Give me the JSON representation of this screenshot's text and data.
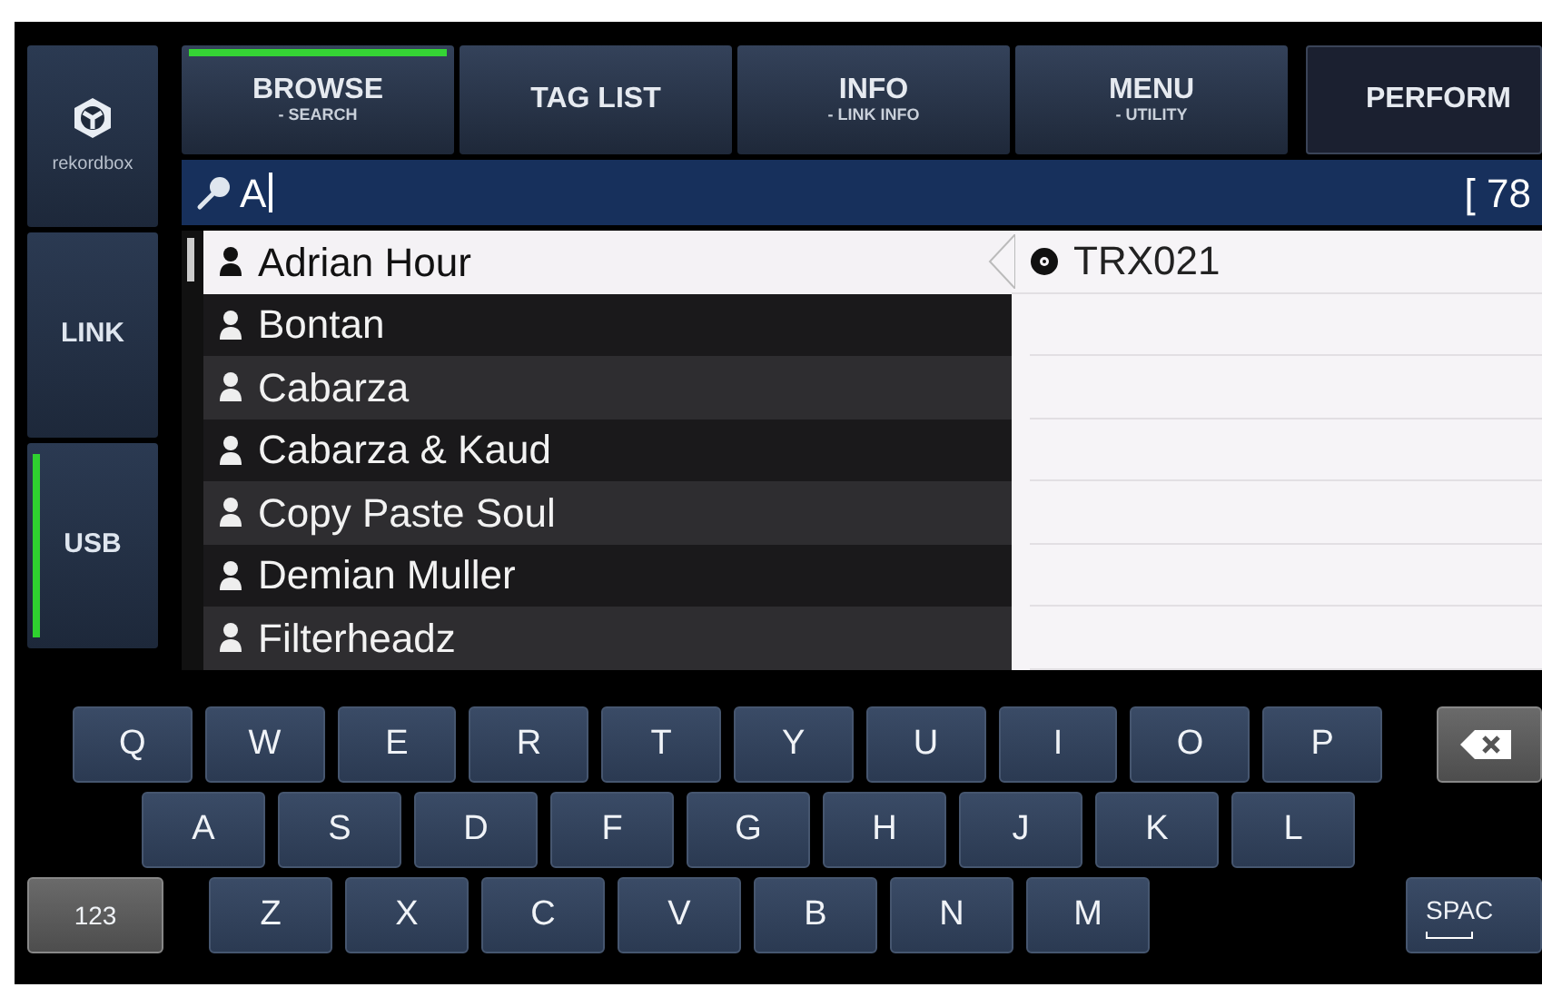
{
  "sidebar": {
    "items": [
      {
        "kind": "logo",
        "label": "rekordbox",
        "selected": false
      },
      {
        "kind": "source",
        "label": "LINK",
        "selected": false
      },
      {
        "kind": "source",
        "label": "USB",
        "selected": true
      }
    ]
  },
  "tabs": [
    {
      "label": "BROWSE",
      "sublabel": "- SEARCH",
      "selected": true
    },
    {
      "label": "TAG LIST",
      "selected": false
    },
    {
      "label": "INFO",
      "sublabel": "- LINK INFO",
      "selected": false
    },
    {
      "label": "MENU",
      "sublabel": "- UTILITY",
      "selected": false
    },
    {
      "label": "PERFORM",
      "selected": false
    }
  ],
  "search": {
    "value": "A",
    "count": "[ 78"
  },
  "artists": [
    {
      "name": "Adrian Hour",
      "selected": true
    },
    {
      "name": "Bontan",
      "selected": false
    },
    {
      "name": "Cabarza",
      "selected": false
    },
    {
      "name": "Cabarza & Kaud",
      "selected": false
    },
    {
      "name": "Copy Paste Soul",
      "selected": false
    },
    {
      "name": "Demian Muller",
      "selected": false
    },
    {
      "name": "Filterheadz",
      "selected": false
    }
  ],
  "albums": [
    {
      "title": "TRX021"
    }
  ],
  "keyboard": {
    "rows": [
      [
        {
          "kind": "letter",
          "label": "Q"
        },
        {
          "kind": "letter",
          "label": "W"
        },
        {
          "kind": "letter",
          "label": "E"
        },
        {
          "kind": "letter",
          "label": "R"
        },
        {
          "kind": "letter",
          "label": "T"
        },
        {
          "kind": "letter",
          "label": "Y"
        },
        {
          "kind": "letter",
          "label": "U"
        },
        {
          "kind": "letter",
          "label": "I"
        },
        {
          "kind": "letter",
          "label": "O"
        },
        {
          "kind": "letter",
          "label": "P"
        },
        {
          "kind": "backspace"
        }
      ],
      [
        {
          "kind": "letter",
          "label": "A"
        },
        {
          "kind": "letter",
          "label": "S"
        },
        {
          "kind": "letter",
          "label": "D"
        },
        {
          "kind": "letter",
          "label": "F"
        },
        {
          "kind": "letter",
          "label": "G"
        },
        {
          "kind": "letter",
          "label": "H"
        },
        {
          "kind": "letter",
          "label": "J"
        },
        {
          "kind": "letter",
          "label": "K"
        },
        {
          "kind": "letter",
          "label": "L"
        }
      ],
      [
        {
          "kind": "function",
          "label": "123"
        },
        {
          "kind": "letter",
          "label": "Z"
        },
        {
          "kind": "letter",
          "label": "X"
        },
        {
          "kind": "letter",
          "label": "C"
        },
        {
          "kind": "letter",
          "label": "V"
        },
        {
          "kind": "letter",
          "label": "B"
        },
        {
          "kind": "letter",
          "label": "N"
        },
        {
          "kind": "letter",
          "label": "M"
        },
        {
          "kind": "space",
          "label": "SPAC"
        }
      ]
    ]
  }
}
